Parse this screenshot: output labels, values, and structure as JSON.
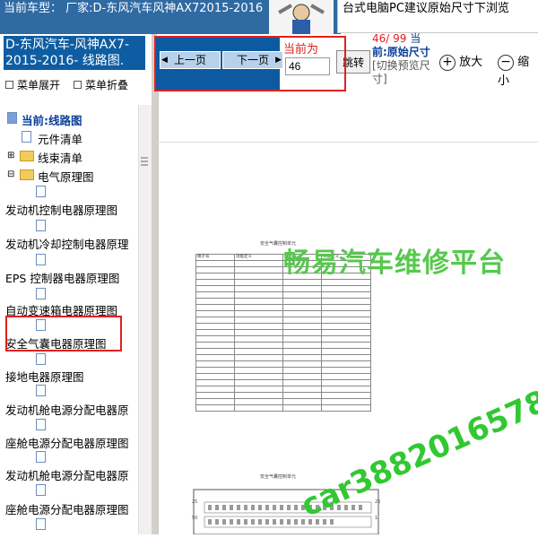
{
  "header": {
    "car_model": "当前车型： 厂家:D-东风汽车风神AX72015-2016",
    "notice": "台式电脑PC建议原始尺寸下浏览"
  },
  "sidebar": {
    "model_title": "D-东风汽车-风神AX7-2015-2016- 线路图.",
    "expand_label": "菜单展开",
    "collapse_label": "菜单折叠",
    "current_label": "当前:线路图",
    "items": [
      {
        "label": "元件清单"
      },
      {
        "label": "线束清单"
      },
      {
        "label": "电气原理图"
      },
      {
        "label": "发动机控制电器原理图"
      },
      {
        "label": "发动机冷却控制电器原理"
      },
      {
        "label": "EPS 控制器电器原理图"
      },
      {
        "label": "自动变速箱电器原理图"
      },
      {
        "label": "安全气囊电器原理图"
      },
      {
        "label": "接地电器原理图"
      },
      {
        "label": "发动机舱电源分配电器原"
      },
      {
        "label": "座舱电源分配电器原理图"
      },
      {
        "label": "发动机舱电源分配电器原"
      },
      {
        "label": "座舱电源分配电器原理图"
      }
    ]
  },
  "toolbar": {
    "prev_label": "上一页",
    "next_label": "下一页",
    "current_label": "当前为",
    "page_value": "46",
    "jump_label": "跳转",
    "page_count": "46/ 99",
    "page_suffix": "当",
    "size_text": "前:原始尺寸",
    "size_hint": "[切换预览尺寸]",
    "zoom_in_label": "放大",
    "zoom_out_label": "缩小"
  },
  "document": {
    "title1": "安全气囊控制单元",
    "title2": "安全气囊控制单元",
    "col_headers": [
      "端子号",
      "功能定义",
      "端子号",
      "功能定义"
    ],
    "connector_labels": [
      "25",
      "50",
      "26",
      "1"
    ]
  },
  "watermark": {
    "platform": "畅易汽车维修平台",
    "contact": "car3882016578"
  },
  "colors": {
    "header_bg": "#2f6aa3",
    "nav_bg": "#0d5aa0",
    "highlight_red": "#e02020",
    "watermark_green": "#32c832"
  }
}
